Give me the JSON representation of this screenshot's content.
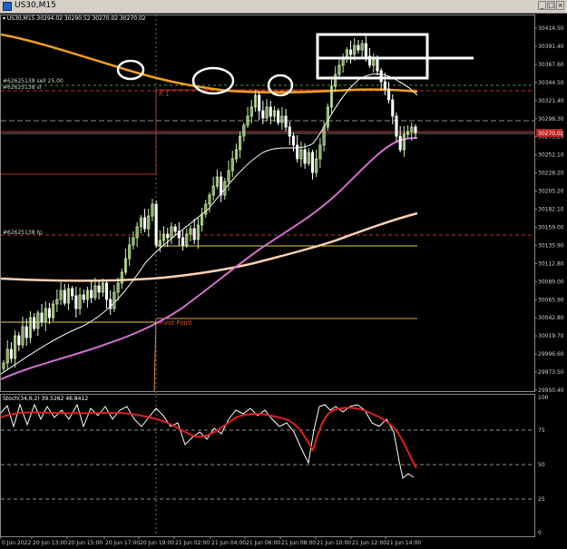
{
  "window": {
    "title": "US30,M15",
    "buttons": [
      "_",
      "□",
      "×"
    ]
  },
  "info_line": "▾ US30,M15  30294.02 30290.52 30270.02 30270.02",
  "price_scale": [
    "30414.50",
    "30391.40",
    "30367.60",
    "30344.50",
    "30321.40",
    "30298.30",
    "30275.20",
    "30252.10",
    "30228.20",
    "30205.20",
    "30182.10",
    "30159.00",
    "30135.90",
    "30112.80",
    "30089.00",
    "30065.90",
    "30042.80",
    "30019.70",
    "29996.60",
    "29973.50",
    "29950.40"
  ],
  "current_price": "30270.02",
  "levels": {
    "sell_label": "#62625138 sell 25.00",
    "sl_label": "#62625138 sl",
    "tp_label": "#62625138 tp",
    "r1_label": "R 1",
    "pivot_label": "Pivot Point"
  },
  "stoch": {
    "header": "Stoch(34,6,2) 39.5262 46.8412",
    "scale": [
      "100",
      "75",
      "50",
      "25",
      "0"
    ]
  },
  "time_axis": [
    "0 Jun 2022",
    "20 Jun 13:00",
    "20 Jun 15:00",
    "20 Jun 17:00",
    "20 Jun 19:00",
    "21 Jun 02:00",
    "21 Jun 04:00",
    "21 Jun 06:00",
    "21 Jun 08:00",
    "21 Jun 10:00",
    "21 Jun 12:00",
    "21 Jun 14:00"
  ],
  "colors": {
    "bull": "#c8f0a0",
    "bear": "#ffffff",
    "ma_orange": "#f0a020",
    "ma_white": "#ffffff",
    "ma_violet": "#d070d0",
    "ma_peach": "#ffd0b0",
    "stoch_main": "#ffffff",
    "stoch_signal": "#e02020"
  }
}
